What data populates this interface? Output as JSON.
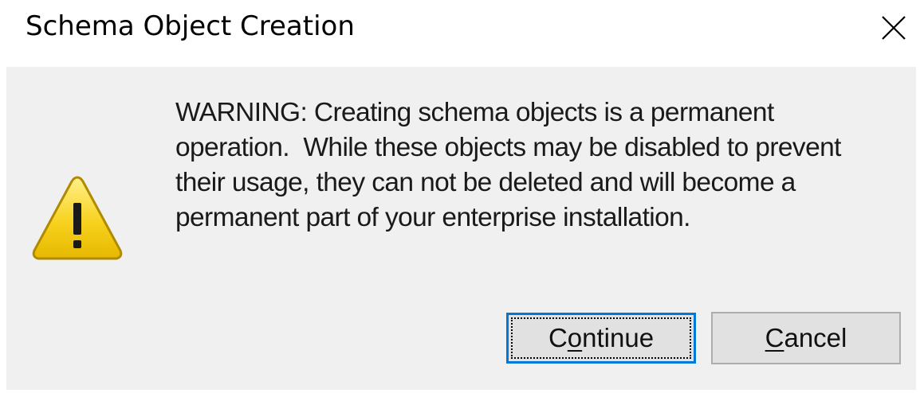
{
  "window": {
    "title": "Schema Object Creation",
    "close_icon": "close-x-icon"
  },
  "message": {
    "icon": "warning-triangle-icon",
    "lines": [
      "WARNING: Creating schema objects is a permanent",
      "operation.  While these objects may be disabled to prevent",
      "their usage, they can not be deleted and will become a",
      "permanent part of your enterprise installation."
    ]
  },
  "buttons": {
    "continue": {
      "pre": "C",
      "accel": "o",
      "post": "ntinue"
    },
    "cancel": {
      "pre": "",
      "accel": "C",
      "post": "ancel"
    }
  },
  "colors": {
    "client_bg": "#f0f0f0",
    "button_bg": "#e1e1e1",
    "default_button_border": "#0078d7",
    "warning_yellow": "#f7d21e"
  }
}
